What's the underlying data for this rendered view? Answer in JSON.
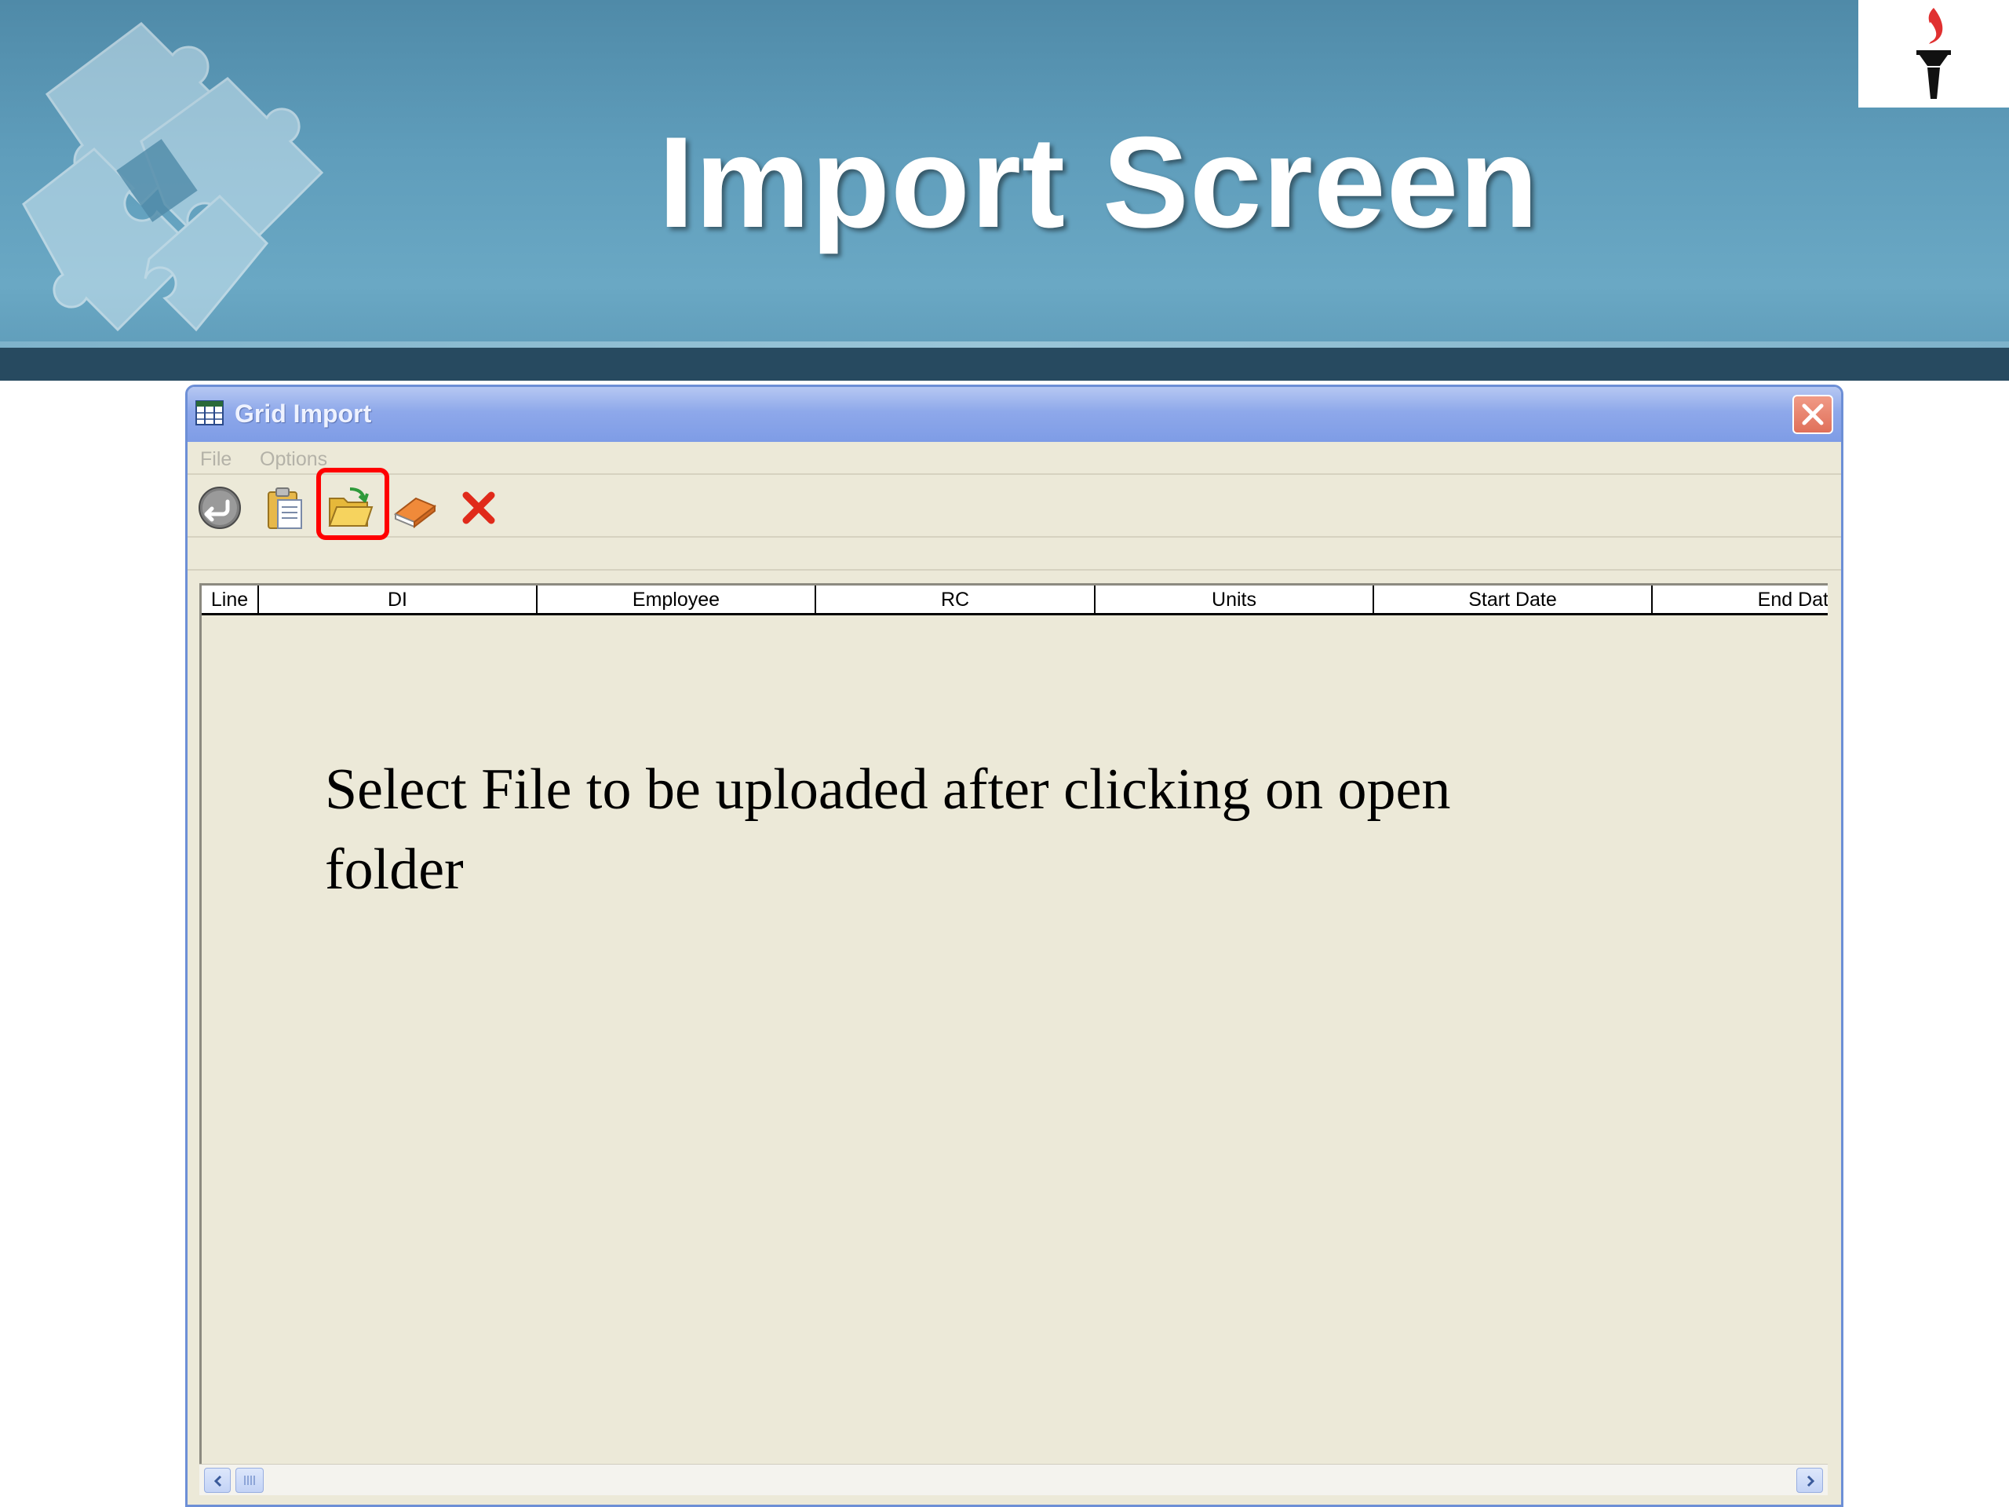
{
  "slide": {
    "title": "Import Screen",
    "instruction": "Select File to be uploaded after clicking on open folder"
  },
  "window": {
    "title": "Grid Import",
    "menu": [
      "File",
      "Options"
    ],
    "toolbar": [
      {
        "icon": "undo-icon"
      },
      {
        "icon": "clipboard-icon"
      },
      {
        "icon": "open-folder-icon",
        "highlighted": true
      },
      {
        "icon": "eraser-icon"
      },
      {
        "icon": "delete-x-icon"
      }
    ],
    "grid_columns": [
      "Line",
      "DI",
      "Employee",
      "RC",
      "Units",
      "Start Date",
      "End Dat"
    ]
  },
  "colors": {
    "banner": "#5f9dbb",
    "banner_dark": "#274a60",
    "window_face": "#ece9d8",
    "titlebar": "#8ea8ea",
    "highlight": "#ff0000",
    "close_button": "#e0705a"
  }
}
